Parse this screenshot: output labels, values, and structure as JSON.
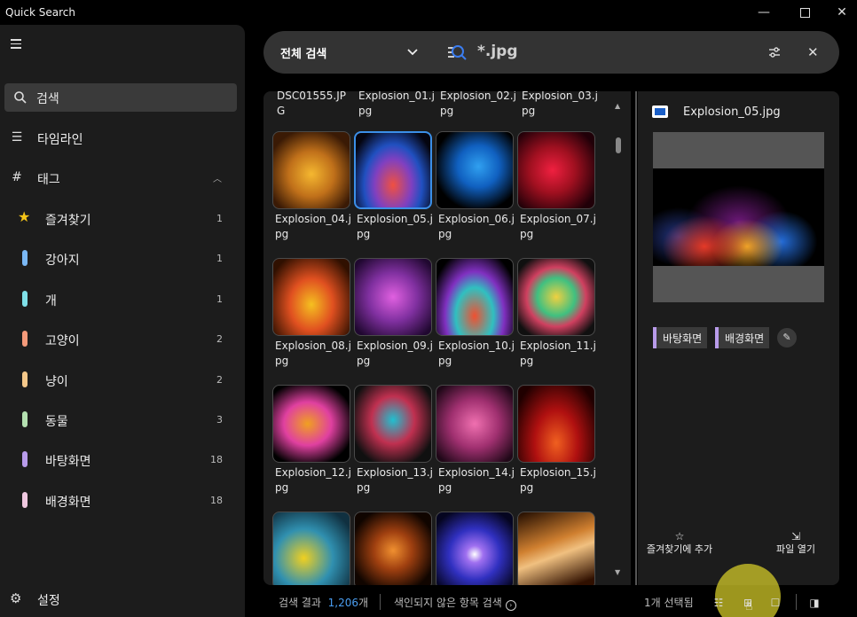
{
  "window": {
    "title": "Quick Search",
    "minimize_icon": "minimize-icon",
    "maximize_icon": "maximize-icon",
    "close_icon": "close-icon"
  },
  "sidebar": {
    "search_label": "검색",
    "timeline_label": "타임라인",
    "tags_header": "태그",
    "tags": [
      {
        "label": "즐겨찾기",
        "count": "1",
        "color": "#f5c518",
        "icon": "star-icon"
      },
      {
        "label": "강아지",
        "count": "1",
        "color": "#7ab8f5"
      },
      {
        "label": "개",
        "count": "1",
        "color": "#7fe0e8"
      },
      {
        "label": "고양이",
        "count": "2",
        "color": "#f59a7a"
      },
      {
        "label": "냥이",
        "count": "2",
        "color": "#f5c88a"
      },
      {
        "label": "동물",
        "count": "3",
        "color": "#b4e0b0"
      },
      {
        "label": "바탕화면",
        "count": "18",
        "color": "#b89bea"
      },
      {
        "label": "배경화면",
        "count": "18",
        "color": "#f0c8e0"
      }
    ],
    "settings_label": "설정"
  },
  "searchbar": {
    "scope": "전체 검색",
    "query": "*.jpg"
  },
  "grid": {
    "top_partial": [
      "DSC01555.JPG",
      "Explosion_01.jpg",
      "Explosion_02.jpg",
      "Explosion_03.jpg"
    ],
    "items": [
      {
        "name": "Explosion_04.jpg"
      },
      {
        "name": "Explosion_05.jpg",
        "selected": true
      },
      {
        "name": "Explosion_06.jpg"
      },
      {
        "name": "Explosion_07.jpg"
      },
      {
        "name": "Explosion_08.jpg"
      },
      {
        "name": "Explosion_09.jpg"
      },
      {
        "name": "Explosion_10.jpg"
      },
      {
        "name": "Explosion_11.jpg"
      },
      {
        "name": "Explosion_12.jpg"
      },
      {
        "name": "Explosion_13.jpg"
      },
      {
        "name": "Explosion_14.jpg"
      },
      {
        "name": "Explosion_15.jpg"
      },
      {
        "name": ""
      },
      {
        "name": ""
      },
      {
        "name": ""
      },
      {
        "name": ""
      }
    ]
  },
  "detail": {
    "filename": "Explosion_05.jpg",
    "tags": [
      "바탕화면",
      "배경화면"
    ],
    "favorite_action": "즐겨찾기에 추가",
    "open_action": "파일 열기"
  },
  "status": {
    "results_label": "검색 결과",
    "results_count": "1,206",
    "results_unit": "개",
    "unindexed_label": "색인되지 않은 항목 검색",
    "selected_label": "1개 선택됨"
  }
}
